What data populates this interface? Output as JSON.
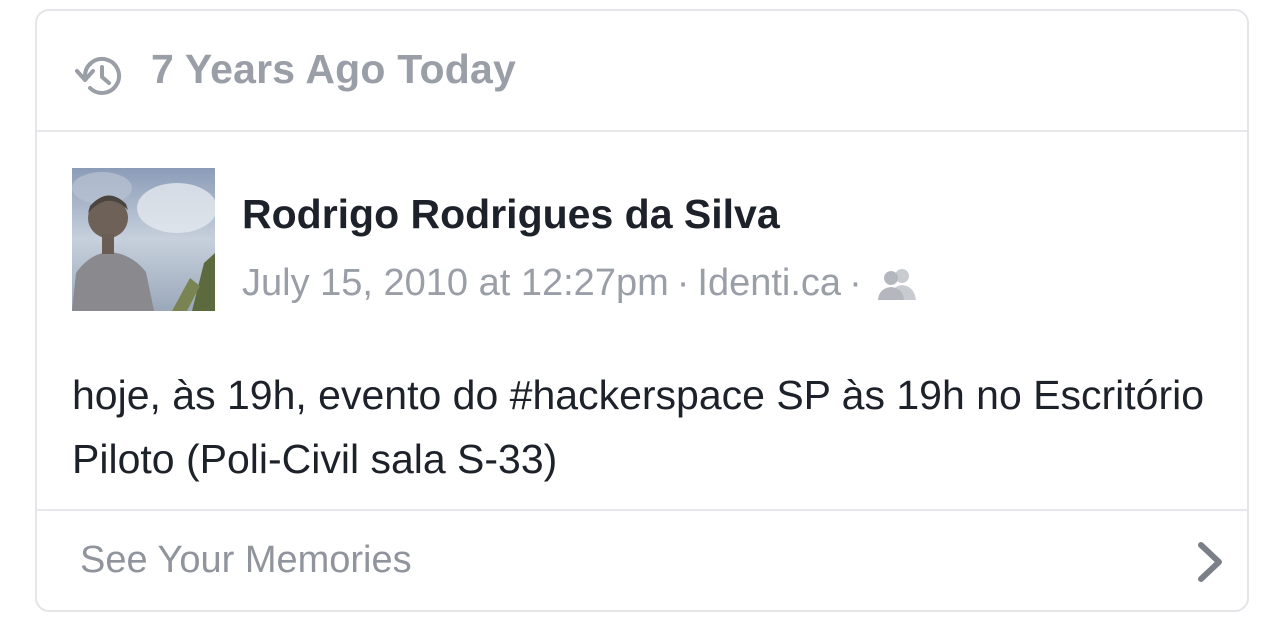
{
  "memory_card": {
    "header": {
      "icon": "history-clock-icon",
      "title": "7 Years Ago Today"
    },
    "post": {
      "author": "Rodrigo Rodrigues da Silva",
      "timestamp": "July 15, 2010 at 12:27pm",
      "separator": "·",
      "source": "Identi.ca",
      "audience_icon": "friends-audience-icon",
      "text": "hoje, às 19h, evento do #hackerspace SP às 19h no Escritório Piloto (Poli-Civil sala S-33)"
    },
    "footer": {
      "label": "See Your Memories",
      "icon": "chevron-right-icon"
    }
  },
  "colors": {
    "muted_text": "#9a9ea6",
    "primary_text": "#1d2129",
    "border": "#e3e5e9"
  }
}
